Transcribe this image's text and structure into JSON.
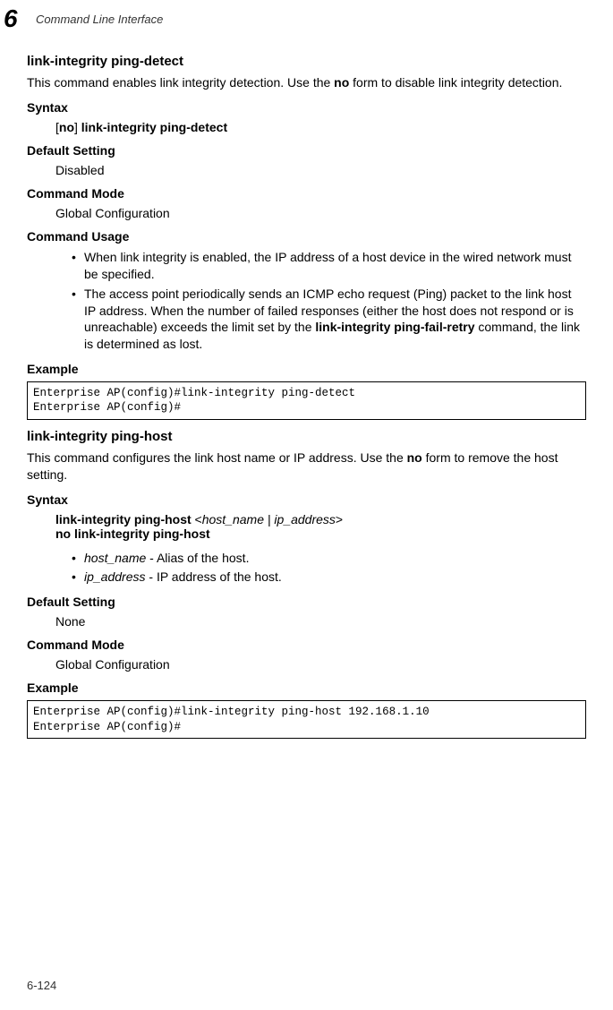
{
  "chapter_number": "6",
  "header_title": "Command Line Interface",
  "section1": {
    "title": "link-integrity ping-detect",
    "description_pre": "This command enables link integrity detection. Use the ",
    "description_bold": "no",
    "description_post": " form to disable link integrity detection.",
    "syntax_heading": "Syntax",
    "syntax_bracket_open": "[",
    "syntax_no": "no",
    "syntax_bracket_close": "] ",
    "syntax_command": "link-integrity ping-detect",
    "default_setting_heading": "Default Setting",
    "default_setting_value": "Disabled",
    "command_mode_heading": "Command Mode",
    "command_mode_value": "Global Configuration",
    "command_usage_heading": "Command Usage",
    "usage_bullets": [
      {
        "text": "When link integrity is enabled, the IP address of a host device in the wired network must be specified."
      },
      {
        "pre": "The access point periodically sends an ICMP echo request (Ping) packet to the link host IP address. When the number of failed responses (either the host does not respond or is unreachable) exceeds the limit set by the ",
        "bold": "link-integrity ping-fail-retry",
        "post": " command, the link is determined as lost."
      }
    ],
    "example_heading": "Example",
    "example_code": "Enterprise AP(config)#link-integrity ping-detect\nEnterprise AP(config)#"
  },
  "section2": {
    "title": "link-integrity ping-host",
    "description_pre": "This command configures the link host name or IP address. Use the ",
    "description_bold": "no",
    "description_post": " form to remove the host setting.",
    "syntax_heading": "Syntax",
    "syntax_line1_bold": "link-integrity ping-host ",
    "syntax_line1_open": "<",
    "syntax_line1_italic": "host_name | ip_address",
    "syntax_line1_close": ">",
    "syntax_line2_bold": "no link-integrity ping-host",
    "syntax_bullets": [
      {
        "italic": "host_name",
        "text": " - Alias of the host."
      },
      {
        "italic": "ip_address",
        "text": " - IP address of the host."
      }
    ],
    "default_setting_heading": "Default Setting",
    "default_setting_value": "None",
    "command_mode_heading": "Command Mode",
    "command_mode_value": "Global Configuration",
    "example_heading": "Example",
    "example_code": "Enterprise AP(config)#link-integrity ping-host 192.168.1.10\nEnterprise AP(config)#"
  },
  "page_number": "6-124"
}
